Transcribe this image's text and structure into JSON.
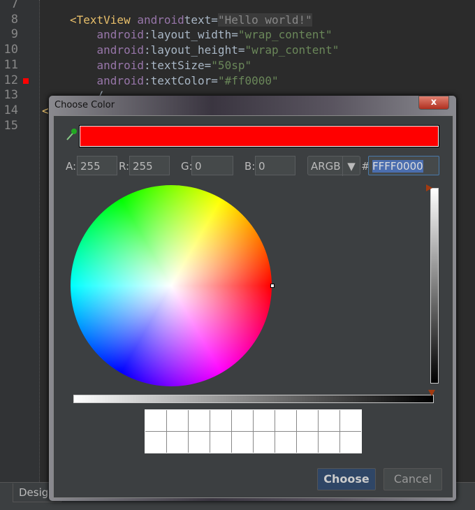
{
  "editor": {
    "lines": [
      {
        "n": "7",
        "parts": []
      },
      {
        "n": "8",
        "parts": [
          [
            "tag",
            "<TextView "
          ],
          [
            "attr",
            "android"
          ],
          [
            "",
            "text="
          ],
          [
            "hl",
            "\"Hello world!\""
          ]
        ]
      },
      {
        "n": "9",
        "parts": [
          [
            "attr",
            "    android"
          ],
          [
            "",
            ":layout_width="
          ],
          [
            "str",
            "\"wrap_content\""
          ]
        ]
      },
      {
        "n": "10",
        "parts": [
          [
            "attr",
            "    android"
          ],
          [
            "",
            ":layout_height="
          ],
          [
            "str",
            "\"wrap_content\""
          ]
        ]
      },
      {
        "n": "11",
        "parts": [
          [
            "attr",
            "    android"
          ],
          [
            "",
            ":textSize="
          ],
          [
            "str",
            "\"50sp\""
          ]
        ]
      },
      {
        "n": "12",
        "parts": [
          [
            "attr",
            "    android"
          ],
          [
            "",
            ":textColor="
          ],
          [
            "str",
            "\"#ff0000\""
          ]
        ]
      },
      {
        "n": "13",
        "parts": [
          [
            "",
            "    /"
          ]
        ]
      },
      {
        "n": "14",
        "parts": [
          [
            "tag",
            "<"
          ]
        ]
      },
      {
        "n": "15",
        "parts": []
      }
    ],
    "design_tab": "Design"
  },
  "dialog": {
    "title": "Choose Color",
    "close": "x",
    "preview_color": "#ff0000",
    "fields": {
      "a_label": "A:",
      "a": "255",
      "r_label": "R:",
      "r": "255",
      "g_label": "G:",
      "g": "0",
      "b_label": "B:",
      "b": "0"
    },
    "mode": "ARGB",
    "hash": "#",
    "hex": "FFFF0000",
    "choose": "Choose",
    "cancel": "Cancel"
  }
}
